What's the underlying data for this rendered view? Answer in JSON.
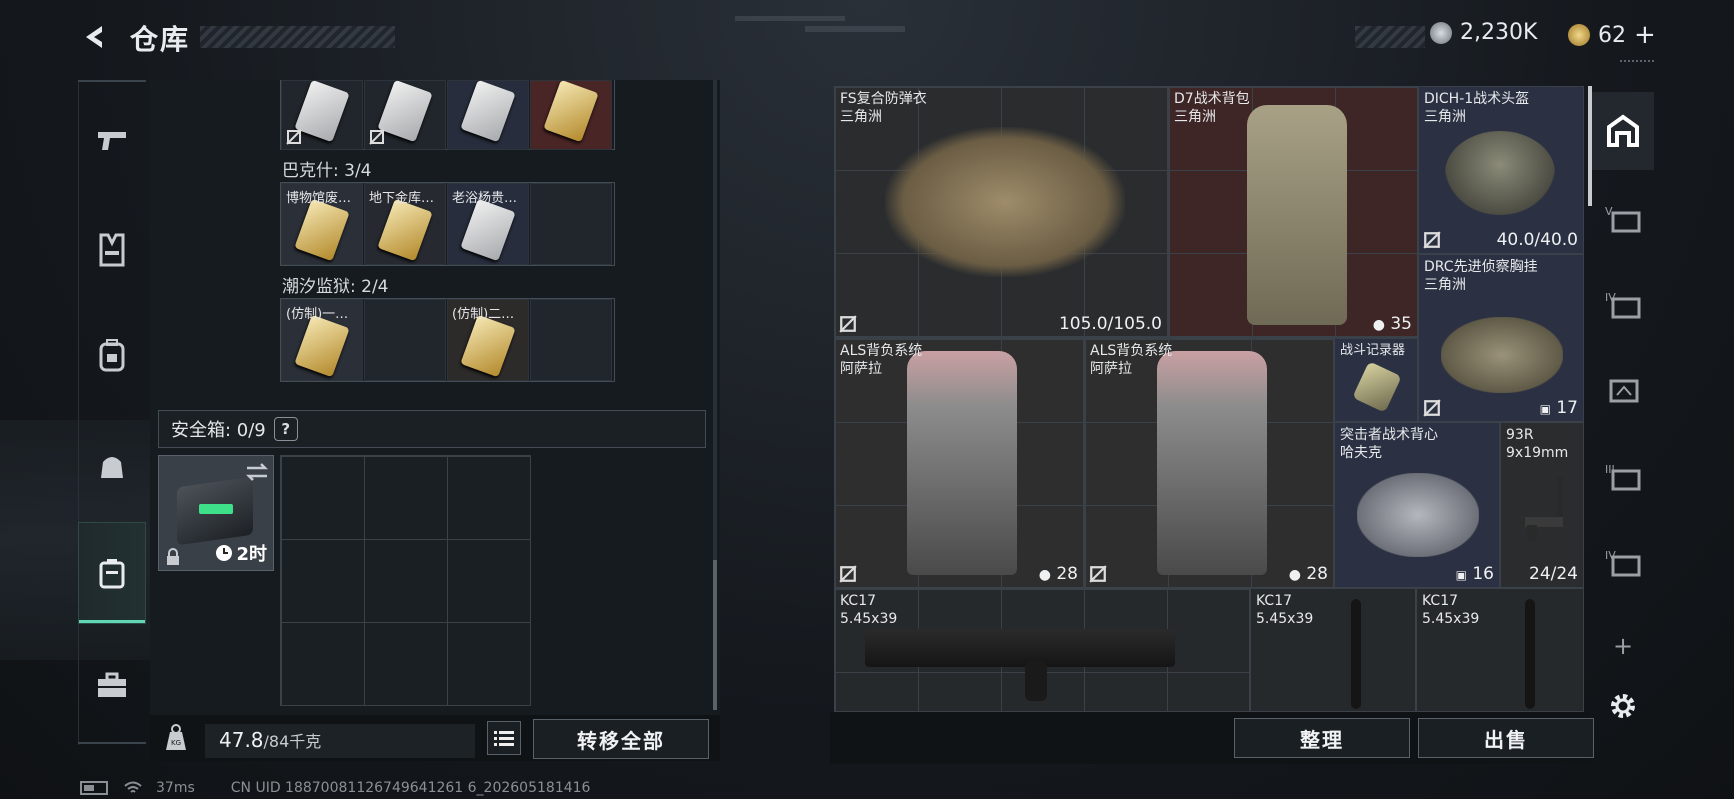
{
  "header": {
    "title": "仓库",
    "currency_primary": "2,230K",
    "currency_secondary": "62",
    "add_label": "+"
  },
  "left": {
    "groups": [
      {
        "label": "巴克什: 3/4"
      },
      {
        "label": "潮汐监狱: 2/4"
      }
    ],
    "slots_row2": [
      "博物馆废…",
      "地下金库…",
      "老浴杨贵…"
    ],
    "slots_row3": [
      "(仿制)一…",
      "",
      "(仿制)二…",
      ""
    ],
    "safebox_label": "安全箱: 0/9",
    "help": "?",
    "safebox_timer": "2时",
    "weight": "47.8",
    "weight_max": "/84千克",
    "transfer_all": "转移全部"
  },
  "items": [
    {
      "name": "FS复合防弹衣",
      "sub": "三角洲",
      "value": "105.0/105.0"
    },
    {
      "name": "D7战术背包",
      "sub": "三角洲",
      "value": "35"
    },
    {
      "name": "DICH-1战术头盔",
      "sub": "三角洲",
      "value": "40.0/40.0"
    },
    {
      "name": "DRC先进侦察胸挂",
      "sub": "三角洲",
      "value": "17"
    },
    {
      "name": "ALS背负系统",
      "sub": "阿萨拉",
      "value": "28"
    },
    {
      "name": "ALS背负系统",
      "sub": "阿萨拉",
      "value": "28"
    },
    {
      "name": "战斗记录器",
      "sub": "",
      "value": ""
    },
    {
      "name": "突击者战术背心",
      "sub": "哈夫克",
      "value": "16"
    },
    {
      "name": "93R",
      "sub": "9x19mm",
      "value": "24/24"
    },
    {
      "name": "KC17",
      "sub": "5.45x39",
      "value": ""
    },
    {
      "name": "KC17",
      "sub": "5.45x39",
      "value": ""
    },
    {
      "name": "KC17",
      "sub": "5.45x39",
      "value": ""
    }
  ],
  "buttons": {
    "sort": "整理",
    "sell": "出售"
  },
  "footer": {
    "ping": "37ms",
    "uid": "CN UID 18870081126749641261 6_202605181416"
  },
  "colors": {
    "accent": "#5fd6b4",
    "red_rarity": "#4a2526",
    "blue_rarity": "#2b3142",
    "gold_rarity": "#3a3026"
  }
}
